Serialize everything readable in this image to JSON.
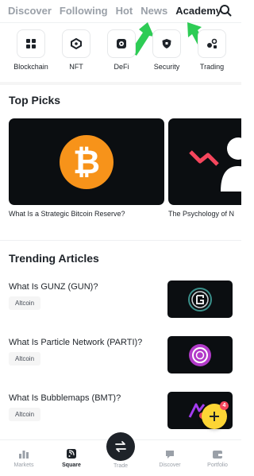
{
  "tabs": {
    "items": [
      {
        "label": "Discover"
      },
      {
        "label": "Following"
      },
      {
        "label": "Hot"
      },
      {
        "label": "News"
      },
      {
        "label": "Academy"
      }
    ],
    "active": "Academy",
    "search_icon": "search-icon"
  },
  "categories": [
    {
      "label": "Blockchain",
      "icon": "blocks-icon"
    },
    {
      "label": "NFT",
      "icon": "nft-icon"
    },
    {
      "label": "DeFi",
      "icon": "defi-icon"
    },
    {
      "label": "Security",
      "icon": "shield-icon"
    },
    {
      "label": "Trading",
      "icon": "trading-icon"
    }
  ],
  "top_picks": {
    "title": "Top Picks",
    "items": [
      {
        "title": "What Is a Strategic Bitcoin Reserve?",
        "image": "bitcoin-logo"
      },
      {
        "title": "The Psychology of N",
        "image": "psychology-illustration"
      }
    ]
  },
  "trending": {
    "title": "Trending Articles",
    "items": [
      {
        "title": "What Is GUNZ (GUN)?",
        "tag": "Altcoin",
        "thumb": "gunz-logo"
      },
      {
        "title": "What Is Particle Network (PARTI)?",
        "tag": "Altcoin",
        "thumb": "particle-logo"
      },
      {
        "title": "What Is Bubblemaps (BMT)?",
        "tag": "Altcoin",
        "thumb": "bubblemaps-logo"
      }
    ]
  },
  "fab": {
    "badge": "4"
  },
  "bottom_nav": {
    "items": [
      {
        "label": "Markets"
      },
      {
        "label": "Square"
      },
      {
        "label": "Trade"
      },
      {
        "label": "Discover"
      },
      {
        "label": "Portfolio"
      }
    ],
    "active": "Square"
  },
  "colors": {
    "accent": "#fcd535",
    "text": "#1e2329",
    "muted": "#9aa0a8",
    "pointer_arrows": "#2ecc55",
    "bitcoin": "#f7931a"
  }
}
